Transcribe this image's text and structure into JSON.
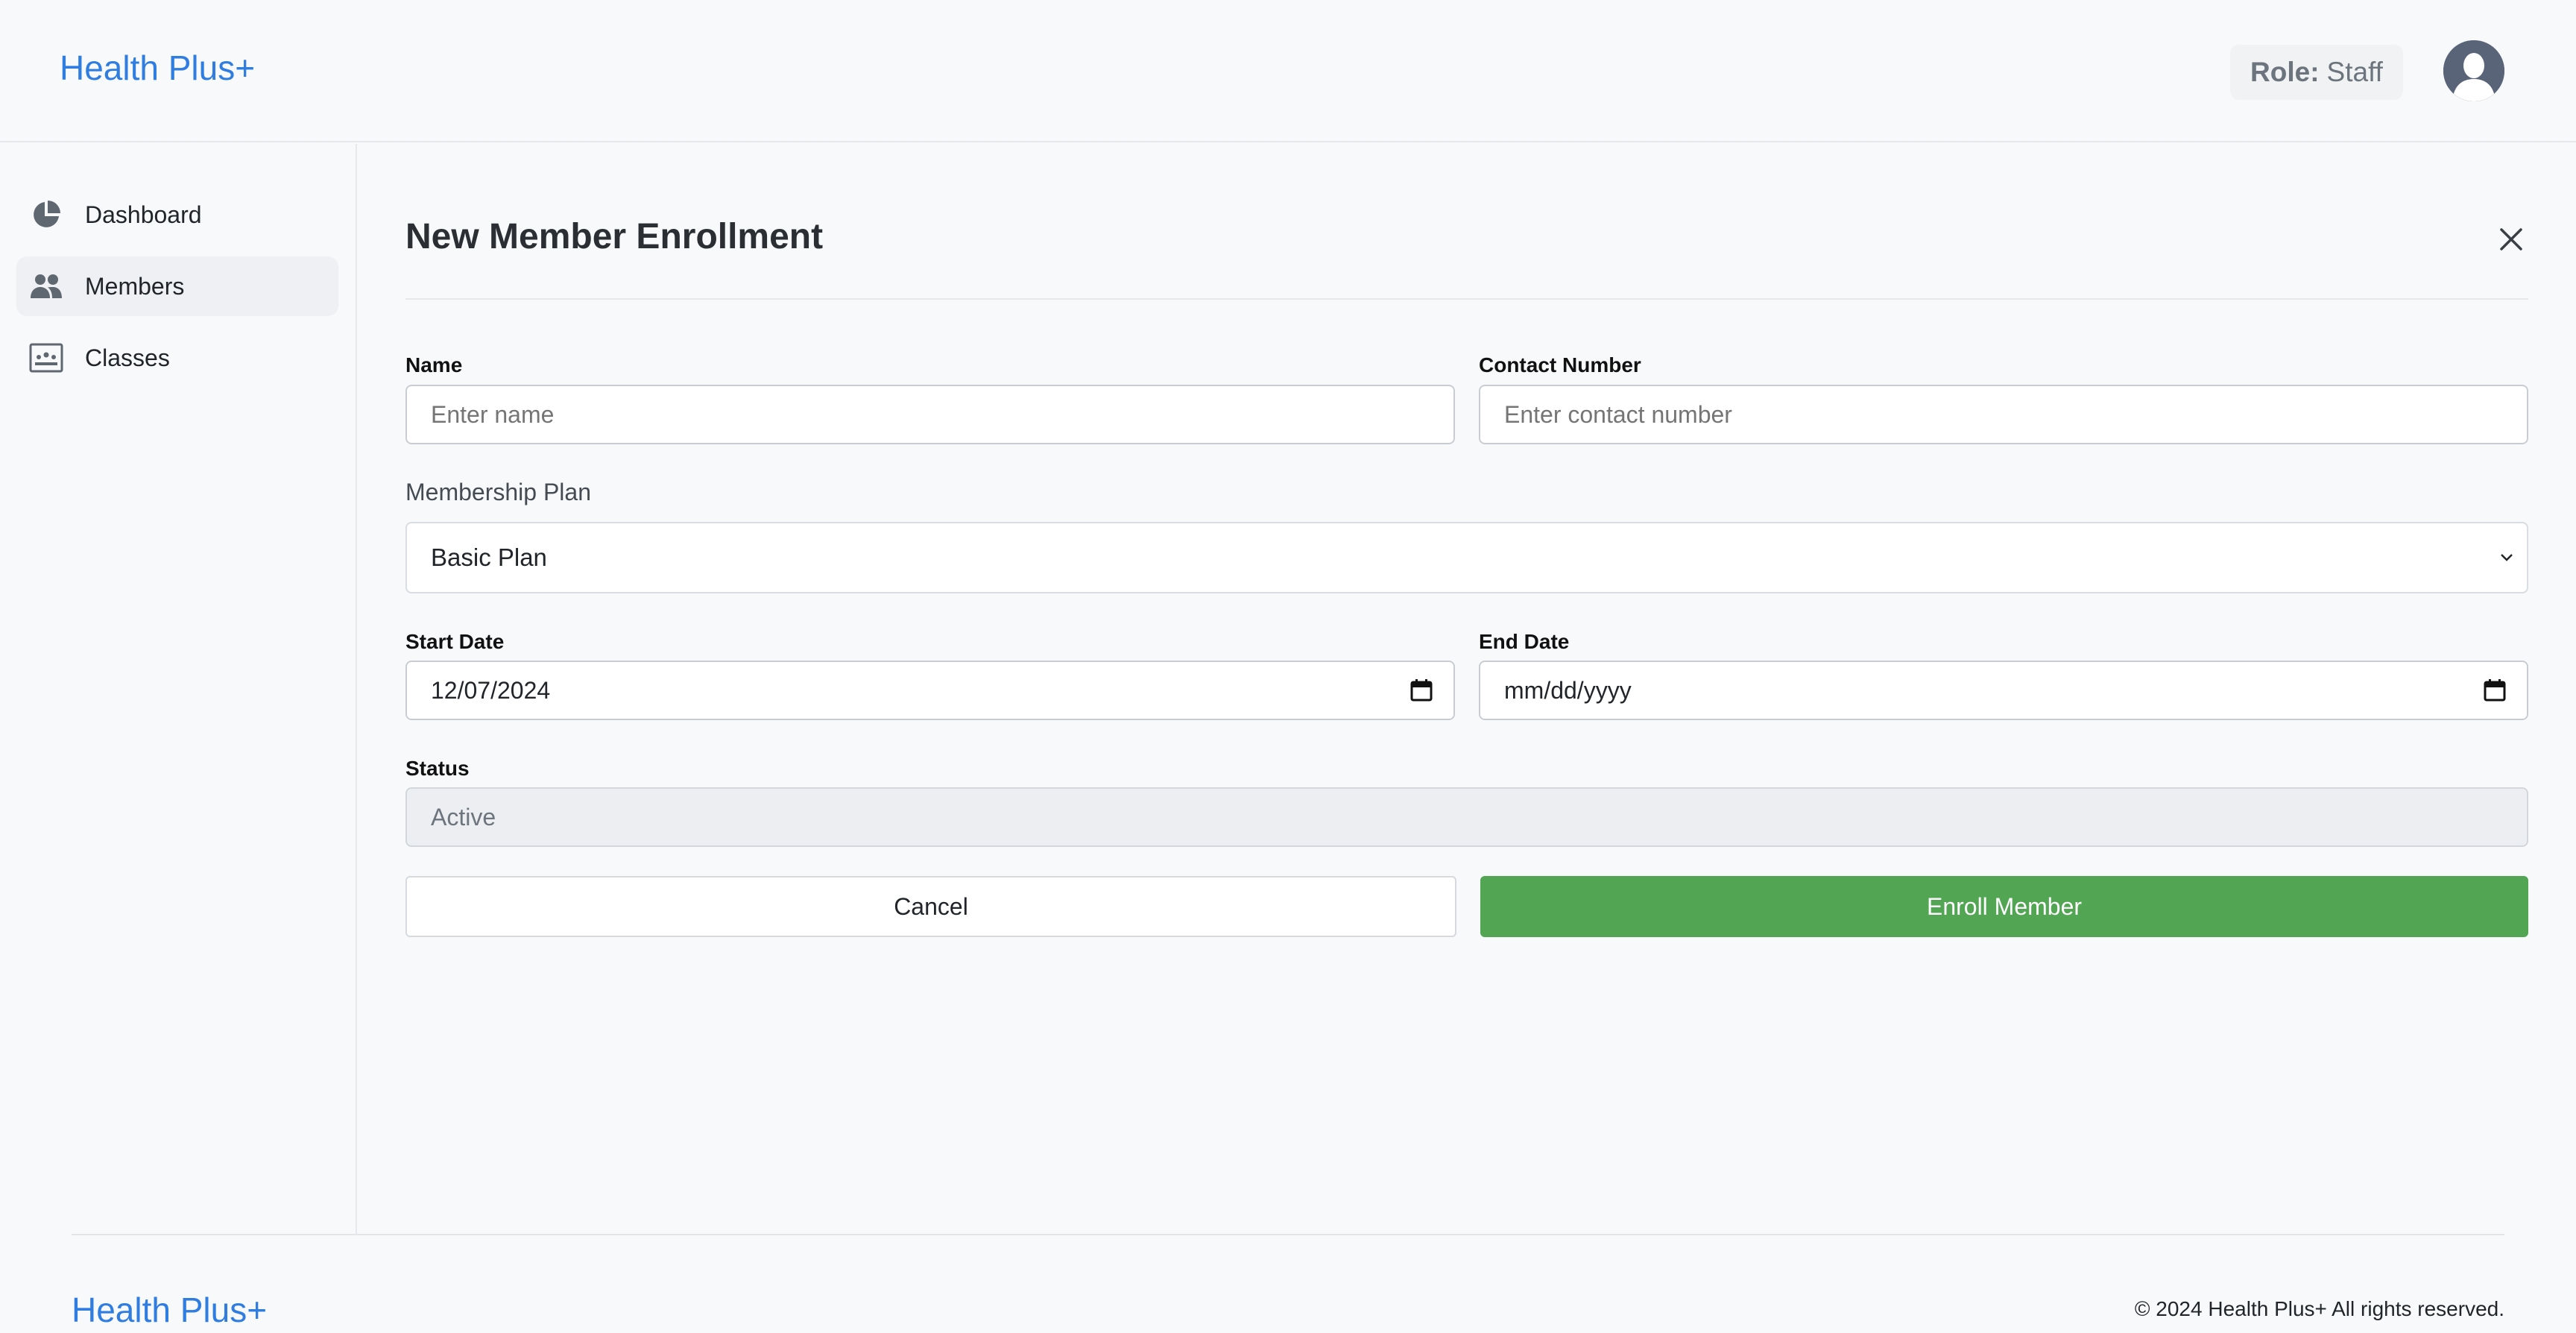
{
  "header": {
    "brand": "Health Plus+",
    "role_key": "Role:",
    "role_value": "Staff"
  },
  "sidebar": {
    "items": [
      {
        "label": "Dashboard",
        "icon": "pie-chart-icon",
        "active": false
      },
      {
        "label": "Members",
        "icon": "people-icon",
        "active": true
      },
      {
        "label": "Classes",
        "icon": "presentation-icon",
        "active": false
      }
    ]
  },
  "form": {
    "title": "New Member Enrollment",
    "name": {
      "label": "Name",
      "value": "",
      "placeholder": "Enter name"
    },
    "contact": {
      "label": "Contact Number",
      "value": "",
      "placeholder": "Enter contact number"
    },
    "plan": {
      "label": "Membership Plan",
      "selected": "Basic Plan"
    },
    "start_date": {
      "label": "Start Date",
      "value": "12/07/2024"
    },
    "end_date": {
      "label": "End Date",
      "value": "",
      "placeholder": "mm/dd/yyyy"
    },
    "status": {
      "label": "Status",
      "value": "Active"
    },
    "cancel_label": "Cancel",
    "submit_label": "Enroll Member"
  },
  "footer": {
    "brand": "Health Plus+",
    "copyright": "© 2024 Health Plus+ All rights reserved."
  },
  "colors": {
    "brand": "#2f7de1",
    "primary_button": "#52a653"
  }
}
